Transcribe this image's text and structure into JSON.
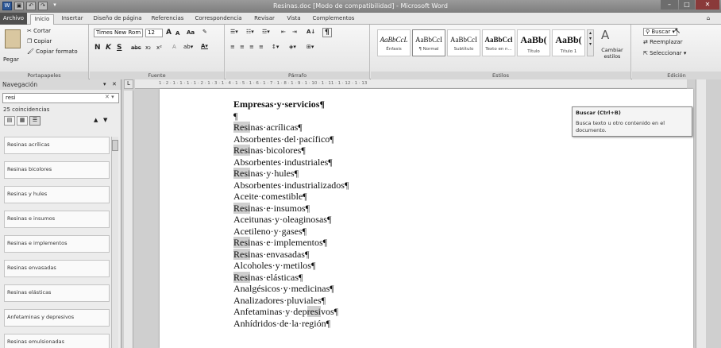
{
  "window": {
    "title": "Resinas.doc [Modo de compatibilidad] - Microsoft Word",
    "controls": {
      "minimize": "–",
      "restore": "□",
      "close": "✕"
    }
  },
  "qat": {
    "save": "▣",
    "undo": "↶",
    "redo": "↷",
    "customize": "▾"
  },
  "tabs": [
    {
      "label": "Archivo"
    },
    {
      "label": "Inicio"
    },
    {
      "label": "Insertar"
    },
    {
      "label": "Diseño de página"
    },
    {
      "label": "Referencias"
    },
    {
      "label": "Correspondencia"
    },
    {
      "label": "Revisar"
    },
    {
      "label": "Vista"
    },
    {
      "label": "Complementos"
    }
  ],
  "ribbon": {
    "clipboard": {
      "paste": "Pegar",
      "cut": "Cortar",
      "copy": "Copiar",
      "format_painter": "Copiar formato",
      "label": "Portapapeles"
    },
    "font": {
      "family": "Times New Rom",
      "size": "12",
      "grow": "A",
      "shrink": "A",
      "case": "Aa",
      "bold": "N",
      "italic": "K",
      "underline": "S",
      "strike": "abc",
      "subscript": "x₂",
      "superscript": "x²",
      "label": "Fuente"
    },
    "paragraph": {
      "label": "Párrafo",
      "sort": "A↓",
      "pilcrow": "¶"
    },
    "styles": {
      "items": [
        {
          "preview": "AaBbCcL",
          "name": "Énfasis"
        },
        {
          "preview": "AaBbCcI",
          "name": "¶ Normal"
        },
        {
          "preview": "AaBbCcI",
          "name": "Subtítulo"
        },
        {
          "preview": "AaBbCcl",
          "name": "Texto en n..."
        },
        {
          "preview": "AaBb(",
          "name": "Título"
        },
        {
          "preview": "AaBb(",
          "name": "Título 1"
        }
      ],
      "change": "Cambiar estilos",
      "label": "Estilos"
    },
    "editing": {
      "find": "Buscar",
      "replace": "Reemplazar",
      "select": "Seleccionar",
      "label": "Edición"
    }
  },
  "nav": {
    "title": "Navegación",
    "search_value": "resi",
    "matches": "25 coincidencias",
    "results": [
      "Resinas acrílicas",
      "Resinas bicolores",
      "Resinas y hules",
      "Resinas e insumos",
      "Resinas e implementos",
      "Resinas envasadas",
      "Resinas elásticas",
      "Anfetaminas y depresivos",
      "Resinas emulsionadas"
    ]
  },
  "tooltip": {
    "title": "Buscar (Ctrl+B)",
    "description": "Busca texto u otro contenido en el documento."
  },
  "ruler": {
    "marks": "1 · 2 · 1 · 1 · 1 · 1 · 2 · 1 · 3 · 1 · 4 · 1 · 5 · 1 · 6 · 1 · 7 · 1 · 8 · 1 · 9 · 1 · 10 · 1 · 11 · 1 · 12 · 1 · 13"
  },
  "document": {
    "heading": "Empresas·y·servicios¶",
    "blank": "¶",
    "lines": [
      {
        "pre": "",
        "hl": "Resi",
        "post": "nas·acrílicas¶"
      },
      {
        "pre": "Absorbentes·del·pacífico¶",
        "hl": "",
        "post": ""
      },
      {
        "pre": "",
        "hl": "Resi",
        "post": "nas·bicolores¶"
      },
      {
        "pre": "Absorbentes·industriales¶",
        "hl": "",
        "post": ""
      },
      {
        "pre": "",
        "hl": "Resi",
        "post": "nas·y·hules¶"
      },
      {
        "pre": "Absorbentes·industrializados¶",
        "hl": "",
        "post": ""
      },
      {
        "pre": "Aceite·comestible¶",
        "hl": "",
        "post": ""
      },
      {
        "pre": "",
        "hl": "Resi",
        "post": "nas·e·insumos¶"
      },
      {
        "pre": "Aceitunas·y·oleaginosas¶",
        "hl": "",
        "post": ""
      },
      {
        "pre": "Acetileno·y·gases¶",
        "hl": "",
        "post": ""
      },
      {
        "pre": "",
        "hl": "Resi",
        "post": "nas·e·implementos¶"
      },
      {
        "pre": "",
        "hl": "Resi",
        "post": "nas·envasadas¶"
      },
      {
        "pre": "Alcoholes·y·metilos¶",
        "hl": "",
        "post": ""
      },
      {
        "pre": "",
        "hl": "Resi",
        "post": "nas·elásticas¶"
      },
      {
        "pre": "Analgésicos·y·medicinas¶",
        "hl": "",
        "post": ""
      },
      {
        "pre": "Analizadores·pluviales¶",
        "hl": "",
        "post": ""
      },
      {
        "pre": "Anfetaminas·y·dep",
        "hl": "resi",
        "post": "vos¶"
      },
      {
        "pre": "Anhídridos·de·la·región¶",
        "hl": "",
        "post": ""
      }
    ]
  }
}
